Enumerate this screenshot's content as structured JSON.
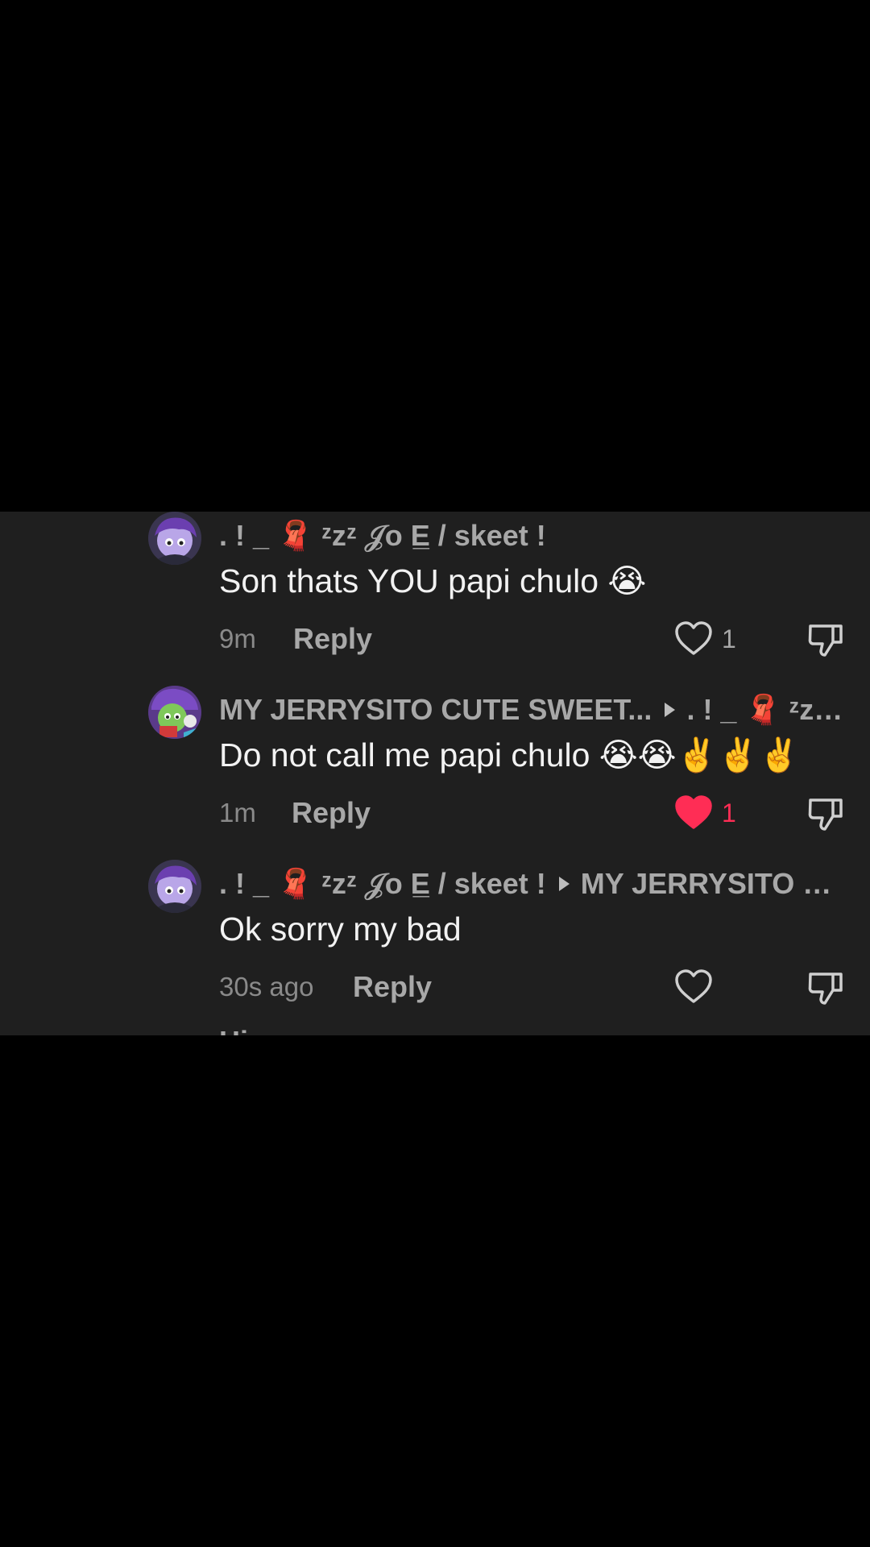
{
  "colors": {
    "panel_background": "#1f1f1f",
    "page_background": "#000000",
    "liked_heart": "#ff2d55",
    "muted_text": "#a8a8a8",
    "primary_text": "#f2f2f2"
  },
  "comments": [
    {
      "username": ". ! _ 🧣 ᶻzᶻ 𝒥o E̲ / skeet !",
      "reply_to": "",
      "text": "Son thats YOU papi chulo 😭",
      "time": "9m",
      "reply_label": "Reply",
      "likes": "1",
      "liked": false,
      "avatar_icon": "avatar-purple-character-icon"
    },
    {
      "username": "MY JERRYSITO CUTE SWEET...",
      "reply_to": ". ! _ 🧣 ᶻzᶻ 𝒥...",
      "text": "Do not call me papi chulo 😭😭✌️✌️✌️",
      "time": "1m",
      "reply_label": "Reply",
      "likes": "1",
      "liked": true,
      "avatar_icon": "avatar-green-character-icon"
    },
    {
      "username": ". ! _ 🧣 ᶻzᶻ 𝒥o E̲ / skeet !",
      "reply_to": "MY JERRYSITO CU...",
      "text": "Ok sorry my bad",
      "time": "30s ago",
      "reply_label": "Reply",
      "likes": "",
      "liked": false,
      "avatar_icon": "avatar-purple-character-icon"
    }
  ],
  "next_comment_peek": "Hi"
}
